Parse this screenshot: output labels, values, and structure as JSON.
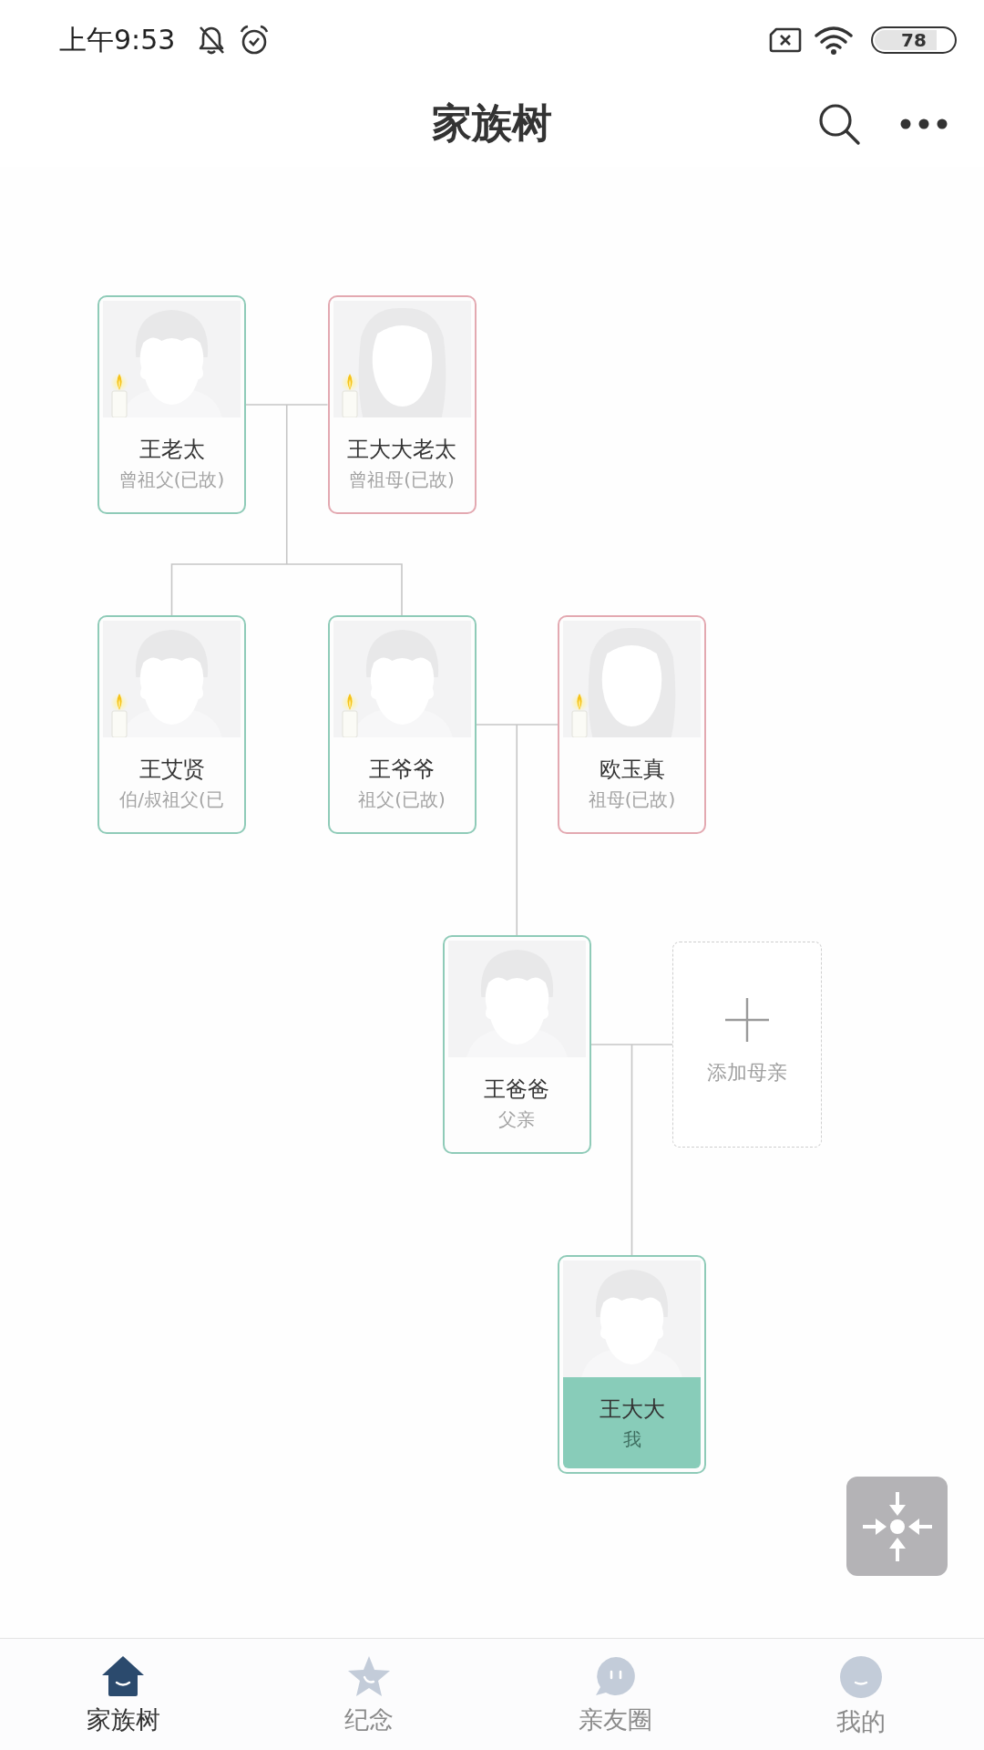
{
  "status_bar": {
    "time": "上午9:53",
    "battery": "78"
  },
  "header": {
    "title": "家族树"
  },
  "tree": {
    "members": [
      {
        "kind": "male",
        "name": "王老太",
        "relation": "曾祖父(已故)",
        "deceased": true,
        "selected": false
      },
      {
        "kind": "female",
        "name": "王大大老太",
        "relation": "曾祖母(已故)",
        "deceased": true,
        "selected": false
      }
    ],
    "children": [
      {
        "members": [
          {
            "kind": "male",
            "name": "王艾贤",
            "relation": "伯/叔祖父(已",
            "deceased": true,
            "selected": false
          }
        ]
      },
      {
        "members": [
          {
            "kind": "male",
            "name": "王爷爷",
            "relation": "祖父(已故)",
            "deceased": true,
            "selected": false
          },
          {
            "kind": "female",
            "name": "欧玉真",
            "relation": "祖母(已故)",
            "deceased": true,
            "selected": false
          }
        ],
        "children": [
          {
            "members": [
              {
                "kind": "male",
                "name": "王爸爸",
                "relation": "父亲",
                "deceased": false,
                "selected": false
              },
              {
                "kind": "add",
                "label": "添加母亲"
              }
            ],
            "children": [
              {
                "members": [
                  {
                    "kind": "male",
                    "name": "王大大",
                    "relation": "我",
                    "deceased": false,
                    "selected": true
                  }
                ]
              }
            ]
          }
        ]
      }
    ]
  },
  "nav": {
    "tabs": [
      {
        "label": "家族树",
        "selected": true
      },
      {
        "label": "纪念",
        "selected": false
      },
      {
        "label": "亲友圈",
        "selected": false
      },
      {
        "label": "我的",
        "selected": false
      }
    ]
  }
}
